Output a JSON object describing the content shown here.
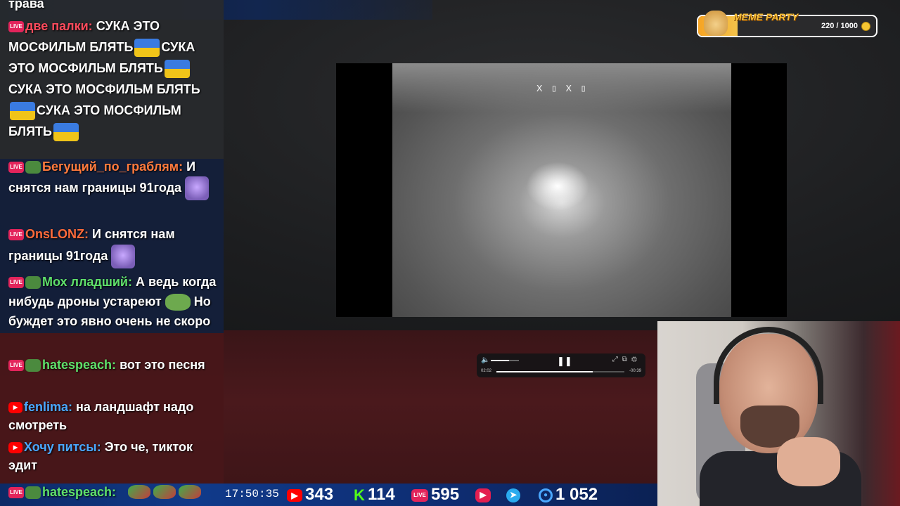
{
  "meme_party": {
    "title": "MEME PARTY",
    "progress_text": "220 / 1000",
    "progress_fraction": 0.22
  },
  "chat": {
    "top_fragment": "трава",
    "messages": [
      {
        "platform": "LIVE",
        "name": "две палки",
        "text_parts": [
          "СУКА ЭТО",
          "МОСФИЛЬМ БЛЯТЬ",
          "СУКА",
          "ЭТО МОСФИЛЬМ БЛЯТЬ",
          "СУКА ЭТО МОСФИЛЬМ",
          "БЛЯТЬ",
          "СУКА ЭТО",
          "МОСФИЛЬМ БЛЯТЬ"
        ]
      },
      {
        "platform": "LIVE",
        "name": "Бегущий_по_граблям",
        "text_parts": [
          "И",
          "снятся нам границы 91года"
        ]
      },
      {
        "platform": "LIVE",
        "name": "OnsLONZ",
        "text_parts": [
          "И снятся нам",
          "границы 91года"
        ]
      },
      {
        "platform": "LIVE",
        "name": "Мох лладший",
        "text_parts": [
          "А ведь",
          "когда нибудь дроны устареют",
          "Но буждет это явно очень",
          "не скоро"
        ]
      },
      {
        "platform": "LIVE",
        "name": "hatespeach",
        "text_parts": [
          "вот это",
          "песня"
        ]
      },
      {
        "platform": "YouTube",
        "name": "fenlima",
        "text_parts": [
          "на ландшафт надо",
          "смотреть"
        ]
      },
      {
        "platform": "YouTube",
        "name": "Хочу питсы",
        "text_parts": [
          "Это че, тикток",
          "эдит"
        ]
      }
    ],
    "live_badge": "LIVE"
  },
  "video": {
    "hud_text": "X ▯ X ▯",
    "time_elapsed": "02:02",
    "time_remaining": "-00:39",
    "seek_fraction": 0.75,
    "volume_fraction": 0.65
  },
  "bottom_bar": {
    "last_user": "hatespeach:",
    "clock": "17:50:35",
    "stats": {
      "youtube": "343",
      "kick": "114",
      "live": "595",
      "viewers": "1 052"
    },
    "live_badge": "LIVE",
    "kick_letter": "K"
  },
  "colors": {
    "live_badge": "#e3245b",
    "youtube": "#ff0000",
    "kick": "#53fc18",
    "meme_accent": "#f6a423"
  }
}
